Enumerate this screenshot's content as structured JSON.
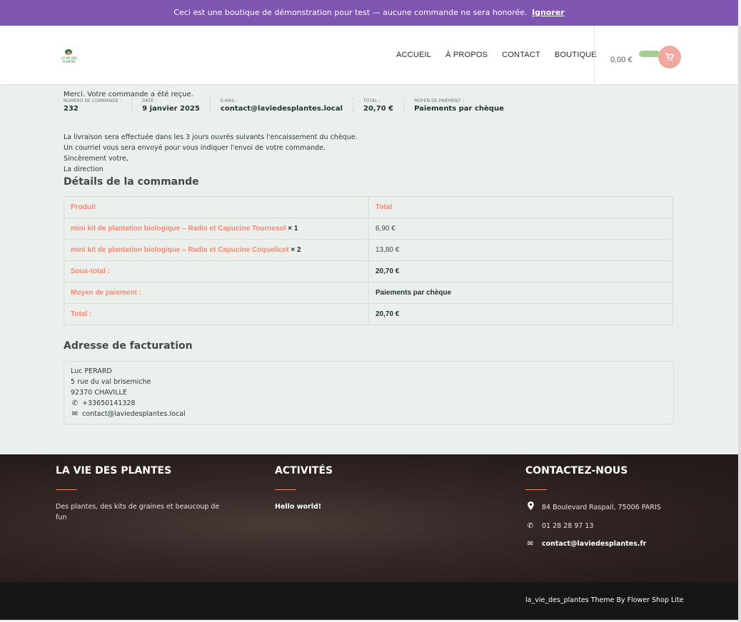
{
  "demo_notice": {
    "text": "Ceci est une boutique de démonstration pour test — aucune commande ne sera honorée.",
    "dismiss": "Ignorer"
  },
  "logo": {
    "text": "LA VIE DES PLANTES"
  },
  "nav": [
    "ACCUEIL",
    "À PROPOS",
    "CONTACT",
    "BOUTIQUE"
  ],
  "cart": {
    "total": "0,00 €",
    "icon": "cart-icon"
  },
  "order": {
    "thanks": "Merci. Votre commande a été reçue.",
    "overview": [
      {
        "label": "NUMÉRO DE COMMANDE :",
        "value": "232"
      },
      {
        "label": "DATE :",
        "value": "9 janvier 2025"
      },
      {
        "label": "E-MAIL :",
        "value": "contact@laviedesplantes.local"
      },
      {
        "label": "TOTAL :",
        "value": "20,70 €"
      },
      {
        "label": "MOYEN DE PAIEMENT :",
        "value": "Paiements par chèque"
      }
    ],
    "notes": [
      "La livraison sera effectuée dans les 3 jours ouvrés suivants l'encaissement du chèque.",
      "Un courriel vous sera envoyé pour vous indiquer l'envoi de votre commande.",
      "Sincèrement votre,",
      "La direction"
    ]
  },
  "details": {
    "title": "Détails de la commande",
    "headers": {
      "product": "Produit",
      "total": "Total"
    },
    "items": [
      {
        "name": "mini kit de plantation biologique – Radis et Capucine Tournesol",
        "qty": "× 1",
        "total": "6,90 €"
      },
      {
        "name": "mini kit de plantation biologique – Radis et Capucine Coquelicot",
        "qty": "× 2",
        "total": "13,80 €"
      }
    ],
    "summary": [
      {
        "label": "Sous-total :",
        "value": "20,70 €"
      },
      {
        "label": "Moyen de paiement :",
        "value": "Paiements par chèque"
      },
      {
        "label": "Total :",
        "value": "20,70 €"
      }
    ]
  },
  "billing": {
    "title": "Adresse de facturation",
    "name": "Luc PERARD",
    "street": "5 rue du val brisemiche",
    "city": "92370 CHAVILLE",
    "phone": "+33650141328",
    "email": "contact@laviedesplantes.local"
  },
  "footer": {
    "col1": {
      "title": "LA VIE DES PLANTES",
      "text": "Des plantes, des kits de graines et beaucoup de fun"
    },
    "col2": {
      "title": "ACTIVITÉS",
      "link": "Hello world!"
    },
    "col3": {
      "title": "CONTACTEZ-NOUS",
      "address": "84 Boulevard Raspail, 75006 PARIS",
      "phone": "01 28 28 97 13",
      "email": "contact@laviedesplantes.fr"
    },
    "credit": "la_vie_des_plantes Theme By Flower Shop Lite"
  },
  "colors": {
    "demo_bar": "#7e56b2",
    "accent": "#ef8a76",
    "cart_button": "#f0a8a0",
    "footer_bg": "#2a201f"
  }
}
